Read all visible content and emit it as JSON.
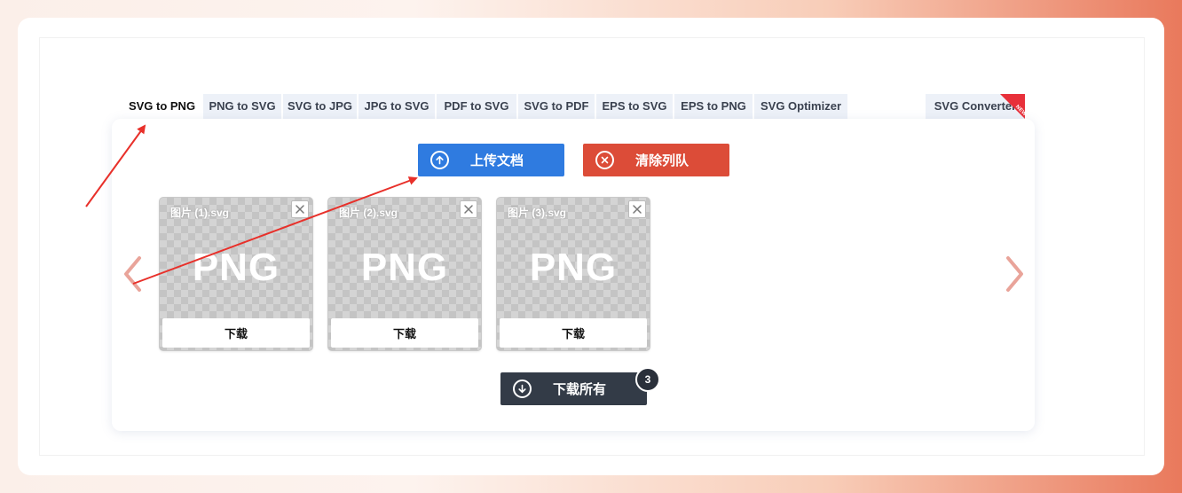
{
  "tabs": [
    {
      "label": "SVG to PNG",
      "active": true
    },
    {
      "label": "PNG to SVG",
      "active": false
    },
    {
      "label": "SVG to JPG",
      "active": false
    },
    {
      "label": "JPG to SVG",
      "active": false
    },
    {
      "label": "PDF to SVG",
      "active": false
    },
    {
      "label": "SVG to PDF",
      "active": false
    },
    {
      "label": "EPS to SVG",
      "active": false
    },
    {
      "label": "EPS to PNG",
      "active": false
    },
    {
      "label": "SVG Optimizer",
      "active": false
    },
    {
      "label": "SVG Converter",
      "active": false,
      "badge": "NEW"
    }
  ],
  "actions": {
    "upload_label": "上传文档",
    "upload_icon": "arrow-up-circle-icon",
    "clear_label": "清除列队",
    "clear_icon": "x-circle-icon",
    "download_all_label": "下载所有",
    "download_all_icon": "arrow-down-circle-icon",
    "file_count": "3"
  },
  "files": [
    {
      "name": "图片 (1).svg",
      "format": "PNG",
      "download_label": "下载"
    },
    {
      "name": "图片 (2).svg",
      "format": "PNG",
      "download_label": "下载"
    },
    {
      "name": "图片 (3).svg",
      "format": "PNG",
      "download_label": "下载"
    }
  ],
  "colors": {
    "upload": "#2f7be0",
    "clear": "#dc4c38",
    "download_all": "#333b47",
    "annotation_arrow": "#e8302a",
    "nav_arrow": "#e9a49a"
  }
}
